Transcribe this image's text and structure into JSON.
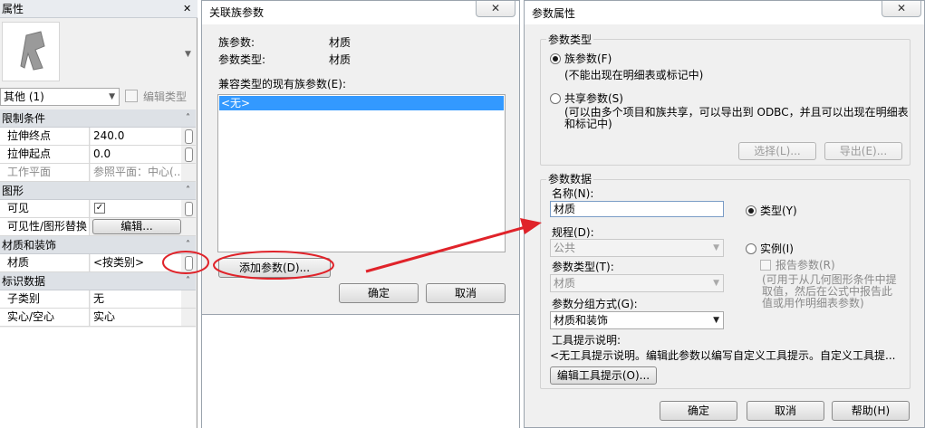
{
  "properties_panel": {
    "title": "属性",
    "type_selector": "其他 (1)",
    "edit_type_label": "编辑类型",
    "categories": {
      "constraints": "限制条件",
      "graphics": "图形",
      "materials": "材质和装饰",
      "identity": "标识数据"
    },
    "rows": {
      "extrusion_end": {
        "name": "拉伸终点",
        "value": "240.0"
      },
      "extrusion_start": {
        "name": "拉伸起点",
        "value": "0.0"
      },
      "work_plane": {
        "name": "工作平面",
        "value": "参照平面：中心(..."
      },
      "visible": {
        "name": "可见"
      },
      "visibility_override": {
        "name": "可见性/图形替换",
        "button": "编辑..."
      },
      "material": {
        "name": "材质",
        "value": "<按类别>"
      },
      "subcategory": {
        "name": "子类别",
        "value": "无"
      },
      "solid_void": {
        "name": "实心/空心",
        "value": "实心"
      }
    }
  },
  "family_param_dialog": {
    "title": "关联族参数",
    "family_param_label": "族参数:",
    "family_param_value": "材质",
    "param_type_label": "参数类型:",
    "param_type_value": "材质",
    "compatible_label": "兼容类型的现有族参数(E):",
    "list_items": [
      "<无>"
    ],
    "add_param_button": "添加参数(D)...",
    "ok_button": "确定",
    "cancel_button": "取消"
  },
  "param_props_dialog": {
    "title": "参数属性",
    "param_type_group": "参数类型",
    "family_param_radio": "族参数(F)",
    "family_param_desc": "(不能出现在明细表或标记中)",
    "shared_param_radio": "共享参数(S)",
    "shared_param_desc_1": "(可以由多个项目和族共享，可以导出到 ODBC，并且可以出现在明细表",
    "shared_param_desc_2": "和标记中)",
    "select_button": "选择(L)...",
    "export_button": "导出(E)...",
    "param_data_group": "参数数据",
    "name_label": "名称(N):",
    "name_value": "材质",
    "discipline_label": "规程(D):",
    "discipline_value": "公共",
    "param_type_label": "参数类型(T):",
    "param_type_value": "材质",
    "group_label": "参数分组方式(G):",
    "group_value": "材质和装饰",
    "type_radio": "类型(Y)",
    "instance_radio": "实例(I)",
    "report_param": "报告参数(R)",
    "report_desc_1": "(可用于从几何图形条件中提",
    "report_desc_2": "取值，然后在公式中报告此",
    "report_desc_3": "值或用作明细表参数)",
    "tooltip_label": "工具提示说明:",
    "tooltip_value": "<无工具提示说明。编辑此参数以编写自定义工具提示。自定义工具提...",
    "edit_tooltip_button": "编辑工具提示(O)...",
    "ok_button": "确定",
    "cancel_button": "取消",
    "help_button": "帮助(H)"
  },
  "close_glyph": "✕",
  "colors": {
    "annotation_red": "#e0232a",
    "selection_blue": "#3399ff"
  }
}
